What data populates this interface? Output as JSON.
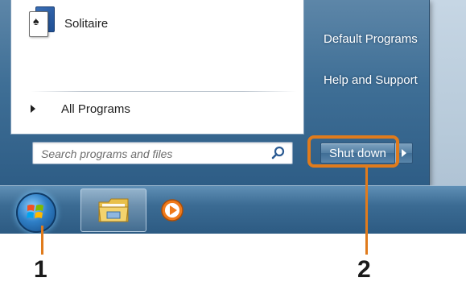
{
  "start_menu": {
    "pinned_programs": [
      {
        "label": "Solitaire",
        "icon": "solitaire-icon"
      }
    ],
    "all_programs_label": "All Programs",
    "search": {
      "placeholder": "Search programs and files",
      "icon": "search-icon"
    },
    "right_pane": {
      "links": [
        "Default Programs",
        "Help and Support"
      ],
      "shutdown_label": "Shut down"
    }
  },
  "taskbar": {
    "start_button": "windows-start-orb",
    "pinned": [
      "windows-explorer",
      "windows-media-player"
    ]
  },
  "callouts": {
    "one": "1",
    "two": "2",
    "color": "#e07b1c"
  }
}
